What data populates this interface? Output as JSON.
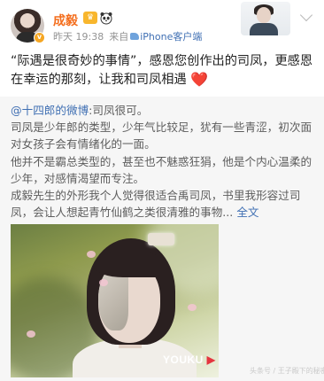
{
  "post": {
    "author": {
      "name": "成毅",
      "avatar_icon": "profile-avatar",
      "badges": [
        "crown-badge-icon",
        "panda-icon"
      ],
      "verified_icon": "verified-v-icon"
    },
    "meta": {
      "date": "昨天 19:38",
      "from_prefix": "来自",
      "source": "iPhone客户端"
    },
    "text": "“际遇是很奇妙的事情”，感恩您创作出的司凤，更感恩在幸运的那刻，让我和司凤相遇",
    "text_emoji": "❤️"
  },
  "repost": {
    "mention": "@十四郎的微博",
    "intro": ":司凤很可。",
    "paragraphs": [
      "司凤是少年郎的类型，少年气比较足，犹有一些青涩，初次面对女孩子会有情绪化的一面。",
      "他并不是霸总类型的，甚至也不魅惑狂狷，他是个内心温柔的少年，对感情渴望而专注。",
      "成毅先生的外形我个人觉得很适合禹司凤，书里我形容过司凤，会让人想起青竹仙鹤之类很清雅的事物..."
    ],
    "full_text_link": "全文",
    "image": {
      "watermark": "YOUKU",
      "watermark_mark": "▶"
    }
  },
  "corner_watermark": "头条号 / 王子殿下的秘密",
  "colors": {
    "username": "#f46d1c",
    "link": "#3f6fb3",
    "heart": "#e02c3a",
    "repost_bg": "#f6f6f6"
  }
}
